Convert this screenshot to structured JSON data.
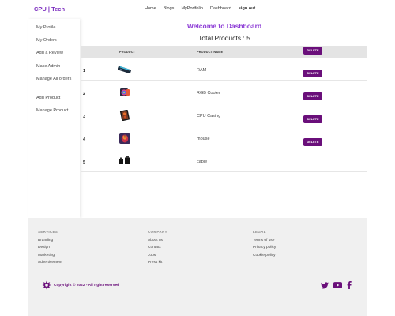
{
  "brand": "CPU | Tech",
  "nav": [
    "Home",
    "Blogs",
    "MyPortfolio",
    "Dashboard",
    "sign out"
  ],
  "sidebar": [
    "My Profile",
    "My Orders",
    "Add a Review",
    "Make Admin",
    "Manage All orders",
    "Add Product",
    "Manage Product"
  ],
  "main": {
    "welcome": "Welcome to Dashboard",
    "total": "Total Products : 5",
    "columns": [
      "PRODUCT",
      "PRODUCT NAME",
      "DELETE"
    ],
    "rows": [
      {
        "num": "1",
        "name": "RAM",
        "thumb": "ram-icon"
      },
      {
        "num": "2",
        "name": "RGB Cooler",
        "thumb": "cooler-icon"
      },
      {
        "num": "3",
        "name": "CPU Casing",
        "thumb": "casing-icon"
      },
      {
        "num": "4",
        "name": "mouse",
        "thumb": "mouse-icon"
      },
      {
        "num": "5",
        "name": "cable",
        "thumb": "cable-icon"
      }
    ],
    "delete_label": "DELETE"
  },
  "footer": {
    "services": {
      "title": "SERVICES",
      "links": [
        "Branding",
        "Design",
        "Marketing",
        "Advertisement"
      ]
    },
    "company": {
      "title": "COMPANY",
      "links": [
        "About us",
        "Contact",
        "Jobs",
        "Press kit"
      ]
    },
    "legal": {
      "title": "LEGAL",
      "links": [
        "Terms of use",
        "Privacy policy",
        "Cookie policy"
      ]
    },
    "copyright": "Copyright © 2022 - All right reserved",
    "socials": [
      "twitter-icon",
      "youtube-icon",
      "facebook-icon"
    ]
  },
  "colors": {
    "accent": "#8e3ed6",
    "button": "#6a0f7a",
    "footer_bg": "#f0f0f0"
  }
}
